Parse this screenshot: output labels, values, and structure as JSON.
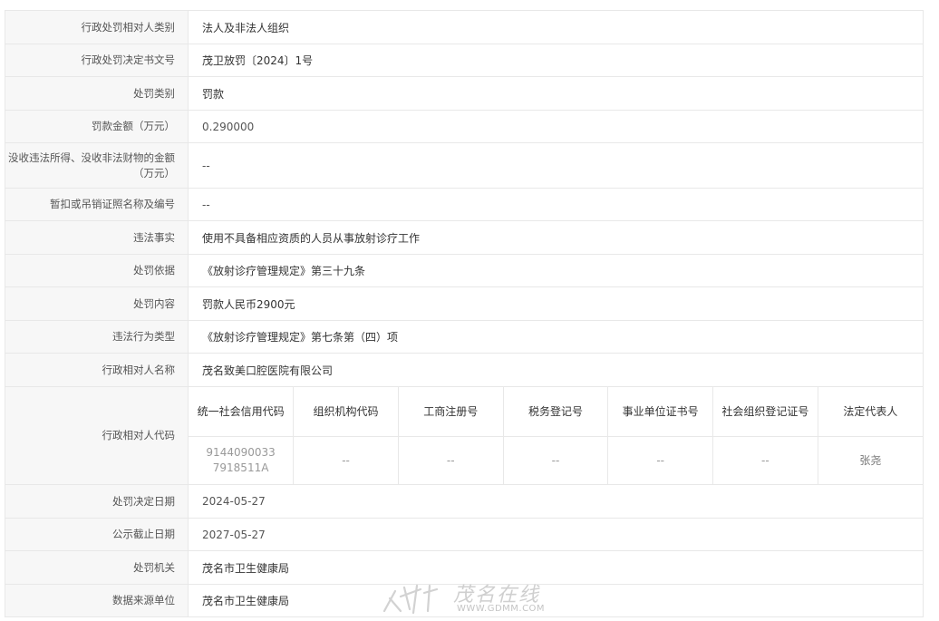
{
  "rows": [
    {
      "label": "行政处罚相对人类别",
      "value": "法人及非法人组织"
    },
    {
      "label": "行政处罚决定书文号",
      "value": "茂卫放罚〔2024〕1号"
    },
    {
      "label": "处罚类别",
      "value": "罚款"
    },
    {
      "label": "罚款金额（万元）",
      "value": "0.290000"
    },
    {
      "label": "没收违法所得、没收非法财物的金额（万元）",
      "value": "--"
    },
    {
      "label": "暂扣或吊销证照名称及编号",
      "value": "--"
    },
    {
      "label": "违法事实",
      "value": "使用不具备相应资质的人员从事放射诊疗工作"
    },
    {
      "label": "处罚依据",
      "value": "《放射诊疗管理规定》第三十九条"
    },
    {
      "label": "处罚内容",
      "value": "罚款人民币2900元"
    },
    {
      "label": "违法行为类型",
      "value": "《放射诊疗管理规定》第七条第（四）项"
    },
    {
      "label": "行政相对人名称",
      "value": "茂名致美口腔医院有限公司"
    }
  ],
  "code_block": {
    "label": "行政相对人代码",
    "headers": [
      "统一社会信用代码",
      "组织机构代码",
      "工商注册号",
      "税务登记号",
      "事业单位证书号",
      "社会组织登记证号",
      "法定代表人"
    ],
    "values": [
      "91440900337918511A",
      "--",
      "--",
      "--",
      "--",
      "--",
      "张尧"
    ]
  },
  "rows_after": [
    {
      "label": "处罚决定日期",
      "value": "2024-05-27"
    },
    {
      "label": "公示截止日期",
      "value": "2027-05-27"
    },
    {
      "label": "处罚机关",
      "value": "茂名市卫生健康局"
    },
    {
      "label": "数据来源单位",
      "value": "茂名市卫生健康局"
    }
  ],
  "watermark": {
    "name": "茂名在线",
    "url": "WWW.GDMM.COM"
  }
}
